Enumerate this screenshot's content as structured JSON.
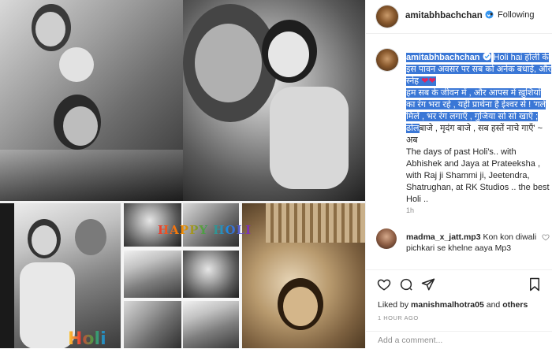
{
  "header": {
    "username": "amitabhbachchan",
    "follow_status": "Following",
    "separator": "•"
  },
  "caption": {
    "username": "amitabhbachchan",
    "hindi_line_1_hl": "Holi hai होली के इस पावन अवसर पर सब को अनेक बधाई, और स्नेह",
    "hindi_line_2_hl": "हम सब के जीवन में , और आपस में ख़ुशियों का रंग भरा रहे , यही प्रार्थना है ईश्वर से ! 'गले मिलें , भर रंग लगाएँ , गुजिया सो सो खाएँ ; ढोल",
    "hindi_line_3_plain": "बाजे , मृदंग बाजे , सब हस्तें नाचे गाएँ' ~ अब",
    "english_text": "The days of past Holi's.. with Abhishek and Jaya at Prateeksha , with Raj ji Shammi ji, Jeetendra, Shatrughan, at RK Studios .. the best Holi ..",
    "timestamp": "1h"
  },
  "comment": {
    "username": "madma_x_jatt.mp3",
    "text": "Kon kon diwali pichkari se khelne aaya Mp3"
  },
  "footer": {
    "liked_by_prefix": "Liked by",
    "liked_by_user": "manishmalhotra05",
    "liked_by_and": "and",
    "liked_by_others": "others",
    "time_ago": "1 HOUR AGO",
    "add_comment_placeholder": "Add a comment..."
  },
  "collage": {
    "logo_text": "HAPPY HOLI",
    "logo_text_bottom": "Holi"
  },
  "colors": {
    "highlight": "#3a77d6",
    "verified": "#3897f0",
    "muted": "#8e8e8e",
    "text": "#262626"
  },
  "icons": [
    "verified-badge-icon",
    "heart-icon",
    "comment-icon",
    "share-icon",
    "bookmark-icon",
    "red-heart-emoji"
  ]
}
